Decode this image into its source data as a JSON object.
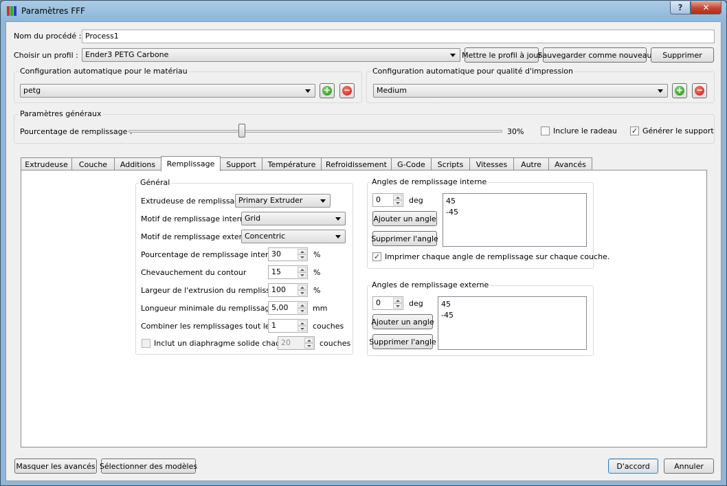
{
  "window": {
    "title": "Paramètres FFF",
    "help_label": "?",
    "close_label": "✕"
  },
  "process": {
    "name_label": "Nom du procédé :",
    "name_value": "Process1"
  },
  "profile": {
    "label": "Choisir un profil :",
    "selected": "Ender3 PETG Carbone",
    "update_label": "Mettre le profil à jour",
    "save_new_label": "Sauvegarder comme nouveau",
    "delete_label": "Supprimer"
  },
  "auto_material": {
    "title": "Configuration automatique pour le matériau",
    "selected": "petg"
  },
  "auto_quality": {
    "title": "Configuration automatique pour qualité d'impression",
    "selected": "Medium"
  },
  "general": {
    "title": "Paramètres généraux",
    "infill_label": "Pourcentage de remplissage :",
    "infill_value": 30,
    "infill_display": "30%",
    "raft_label": "Inclure le radeau",
    "raft_checked": false,
    "support_label": "Générer le support",
    "support_checked": true
  },
  "tabs": [
    {
      "label": "Extrudeuse",
      "active": false
    },
    {
      "label": "Couche",
      "active": false
    },
    {
      "label": "Additions",
      "active": false
    },
    {
      "label": "Remplissage",
      "active": true
    },
    {
      "label": "Support",
      "active": false
    },
    {
      "label": "Température",
      "active": false
    },
    {
      "label": "Refroidissement",
      "active": false
    },
    {
      "label": "G-Code",
      "active": false
    },
    {
      "label": "Scripts",
      "active": false
    },
    {
      "label": "Vitesses",
      "active": false
    },
    {
      "label": "Autre",
      "active": false
    },
    {
      "label": "Avancés",
      "active": false
    }
  ],
  "infill": {
    "group_title": "Général",
    "extruder_label": "Extrudeuse de remplissage",
    "extruder_value": "Primary Extruder",
    "internal_pattern_label": "Motif de remplissage interne",
    "internal_pattern_value": "Grid",
    "external_pattern_label": "Motif de remplissage externe",
    "external_pattern_value": "Concentric",
    "internal_pct_label": "Pourcentage de remplissage interne",
    "internal_pct_value": "30",
    "internal_pct_unit": "%",
    "overlap_label": "Chevauchement du contour",
    "overlap_value": "15",
    "overlap_unit": "%",
    "width_label": "Largeur de l'extrusion du remplissage",
    "width_value": "100",
    "width_unit": "%",
    "min_length_label": "Longueur minimale du remplissage",
    "min_length_value": "5,00",
    "min_length_unit": "mm",
    "combine_label": "Combiner les remplissages tout les",
    "combine_value": "1",
    "combine_unit": "couches",
    "diaphragm_label": "Inclut un diaphragme solide chaque",
    "diaphragm_checked": false,
    "diaphragm_value": "20",
    "diaphragm_unit": "couches"
  },
  "internal_angles": {
    "title": "Angles de remplissage interne",
    "angle_value": "0",
    "unit": "deg",
    "add_label": "Ajouter un angle",
    "remove_label": "Supprimer l'angle",
    "angles": [
      "45",
      "-45"
    ],
    "print_each_label": "Imprimer chaque angle de remplissage sur chaque couche.",
    "print_each_checked": true
  },
  "external_angles": {
    "title": "Angles de remplissage externe",
    "angle_value": "0",
    "unit": "deg",
    "add_label": "Ajouter un angle",
    "remove_label": "Supprimer l'angle",
    "angles": [
      "45",
      "-45"
    ]
  },
  "footer": {
    "hide_advanced_label": "Masquer les avancés",
    "select_models_label": "Sélectionner des modèles",
    "ok_label": "D'accord",
    "cancel_label": "Annuler"
  },
  "colors": {
    "accent": "#3c7fb1",
    "titlebar": "#8eb6d8",
    "close": "#c7442f",
    "add": "#1f8a1a",
    "remove": "#c0190b"
  },
  "icons": {
    "add": "plus-circle-icon",
    "remove": "minus-circle-icon"
  }
}
